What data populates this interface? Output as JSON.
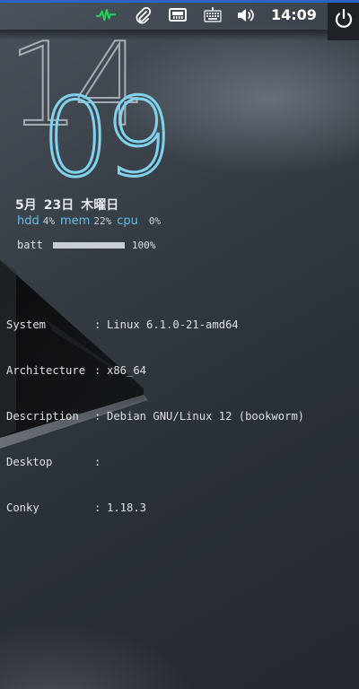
{
  "panel": {
    "clock": "14:09",
    "icons": [
      "system-monitor-icon",
      "paperclip-icon",
      "network-icon",
      "keyboard-icon",
      "volume-icon",
      "power-icon"
    ],
    "accent_color": "#2c63c9",
    "monitor_color": "#22d15a"
  },
  "conky": {
    "hour": "14",
    "minute": "09",
    "date": {
      "month": "5月",
      "day": "23日",
      "weekday": "木曜日"
    },
    "stats": {
      "hdd_label": "hdd",
      "hdd_value": "4%",
      "mem_label": "mem",
      "mem_value": "22%",
      "cpu_label": "cpu",
      "cpu_value": "0%"
    },
    "battery": {
      "label": "batt",
      "percent_text": "100%",
      "level": 1.0
    },
    "system": [
      {
        "key": "System",
        "value": "Linux 6.1.0-21-amd64"
      },
      {
        "key": "Architecture",
        "value": "x86_64"
      },
      {
        "key": "Description",
        "value": "Debian GNU/Linux 12 (bookworm)"
      },
      {
        "key": "Desktop",
        "value": ""
      },
      {
        "key": "Conky",
        "value": "1.18.3"
      }
    ]
  }
}
